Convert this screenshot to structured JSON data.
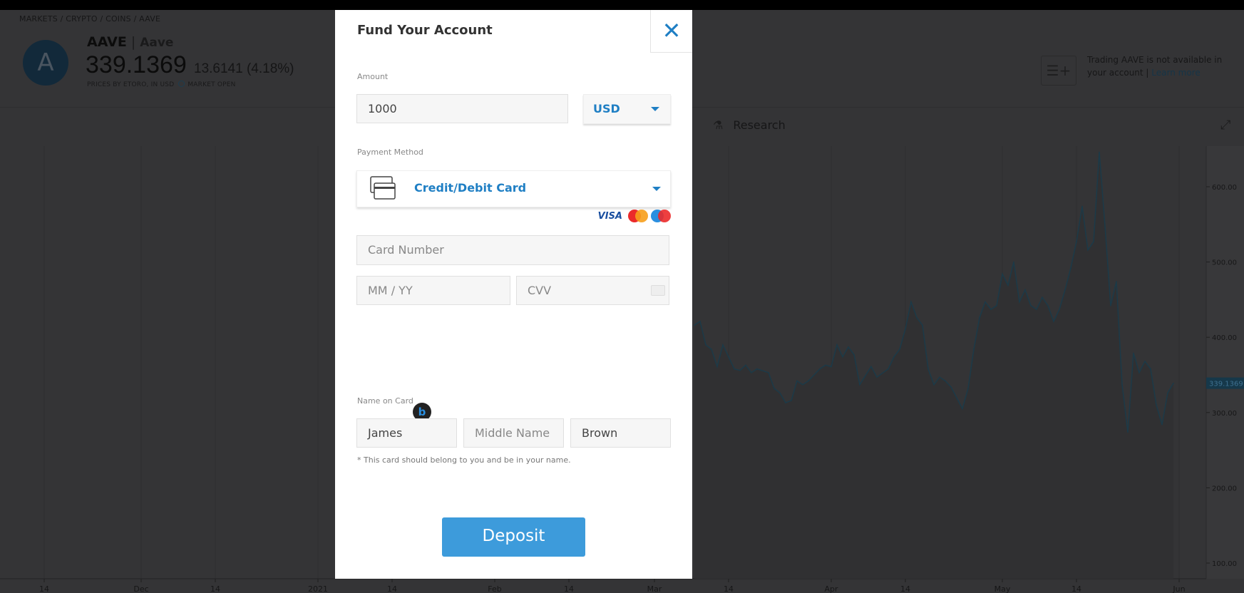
{
  "header": {
    "breadcrumb": "MARKETS / CRYPTO / COINS / AAVE",
    "symbol": "AAVE",
    "separator": "|",
    "name": "Aave",
    "price": "339.1369",
    "change": "13.6141 (4.18%)",
    "source": "PRICES BY ETORO, IN USD",
    "market_status": "MARKET OPEN",
    "logo_letter": "A",
    "unavailable_text": "Trading AAVE is not available in your account |",
    "learn_more": "Learn more",
    "research_tab": "Research"
  },
  "modal": {
    "title": "Fund Your Account",
    "amount_label": "Amount",
    "amount_value": "1000",
    "currency": "USD",
    "payment_label": "Payment Method",
    "payment_method": "Credit/Debit Card",
    "card_logos": [
      "VISA",
      "mastercard",
      "maestro"
    ],
    "card_number_placeholder": "Card Number",
    "expiry_placeholder": "MM / YY",
    "cvv_placeholder": "CVV",
    "name_label": "Name on Card",
    "first_name": "James",
    "middle_placeholder": "Middle Name",
    "last_name": "Brown",
    "note": "* This card should belong to you and be in your name.",
    "deposit_label": "Deposit",
    "pin_letter": "b"
  },
  "colors": {
    "accent": "#1f7fc4",
    "deposit_button": "#3d9bdb",
    "chart_line": "#1a8fc0",
    "overlay": "rgba(15,15,17,0.85)"
  },
  "chart_data": {
    "type": "area",
    "current_price_label": "339.1369",
    "y_ticks": [
      "100.00",
      "200.00",
      "300.00",
      "400.00",
      "500.00",
      "600.00"
    ],
    "ylim": [
      60,
      700
    ],
    "x_ticks": [
      {
        "date": "2020-11-14",
        "label": "14"
      },
      {
        "date": "2020-12-01",
        "label": "Dec"
      },
      {
        "date": "2020-12-14",
        "label": "14"
      },
      {
        "date": "2021-01-01",
        "label": "2021"
      },
      {
        "date": "2021-01-14",
        "label": "14"
      },
      {
        "date": "2021-02-01",
        "label": "Feb"
      },
      {
        "date": "2021-02-14",
        "label": "14"
      },
      {
        "date": "2021-03-01",
        "label": "Mar"
      },
      {
        "date": "2021-03-14",
        "label": "14"
      },
      {
        "date": "2021-04-01",
        "label": "Apr"
      },
      {
        "date": "2021-04-14",
        "label": "14"
      },
      {
        "date": "2021-05-01",
        "label": "May"
      },
      {
        "date": "2021-05-14",
        "label": "14"
      },
      {
        "date": "2021-06-01",
        "label": "Jun"
      }
    ],
    "grid": true,
    "points": [
      [
        "2021-03-08",
        416
      ],
      [
        "2021-03-09",
        421
      ],
      [
        "2021-03-10",
        390
      ],
      [
        "2021-03-11",
        384
      ],
      [
        "2021-03-12",
        361
      ],
      [
        "2021-03-13",
        390
      ],
      [
        "2021-03-14",
        374
      ],
      [
        "2021-03-15",
        358
      ],
      [
        "2021-03-16",
        356
      ],
      [
        "2021-03-17",
        363
      ],
      [
        "2021-03-18",
        353
      ],
      [
        "2021-03-19",
        358
      ],
      [
        "2021-03-21",
        353
      ],
      [
        "2021-03-22",
        332
      ],
      [
        "2021-03-23",
        326
      ],
      [
        "2021-03-24",
        313
      ],
      [
        "2021-03-25",
        316
      ],
      [
        "2021-03-26",
        342
      ],
      [
        "2021-03-27",
        337
      ],
      [
        "2021-03-28",
        342
      ],
      [
        "2021-03-30",
        358
      ],
      [
        "2021-03-31",
        363
      ],
      [
        "2021-04-01",
        361
      ],
      [
        "2021-04-02",
        390
      ],
      [
        "2021-04-03",
        374
      ],
      [
        "2021-04-04",
        387
      ],
      [
        "2021-04-05",
        377
      ],
      [
        "2021-04-06",
        337
      ],
      [
        "2021-04-08",
        361
      ],
      [
        "2021-04-09",
        347
      ],
      [
        "2021-04-11",
        358
      ],
      [
        "2021-04-12",
        374
      ],
      [
        "2021-04-13",
        384
      ],
      [
        "2021-04-14",
        411
      ],
      [
        "2021-04-15",
        447
      ],
      [
        "2021-04-16",
        426
      ],
      [
        "2021-04-17",
        416
      ],
      [
        "2021-04-18",
        358
      ],
      [
        "2021-04-19",
        337
      ],
      [
        "2021-04-20",
        347
      ],
      [
        "2021-04-21",
        342
      ],
      [
        "2021-04-22",
        334
      ],
      [
        "2021-04-24",
        305
      ],
      [
        "2021-04-25",
        332
      ],
      [
        "2021-04-26",
        384
      ],
      [
        "2021-04-27",
        426
      ],
      [
        "2021-04-28",
        447
      ],
      [
        "2021-04-29",
        437
      ],
      [
        "2021-04-30",
        442
      ],
      [
        "2021-05-01",
        484
      ],
      [
        "2021-05-02",
        469
      ],
      [
        "2021-05-03",
        500
      ],
      [
        "2021-05-04",
        447
      ],
      [
        "2021-05-05",
        463
      ],
      [
        "2021-05-06",
        442
      ],
      [
        "2021-05-07",
        437
      ],
      [
        "2021-05-08",
        453
      ],
      [
        "2021-05-09",
        442
      ],
      [
        "2021-05-10",
        421
      ],
      [
        "2021-05-11",
        437
      ],
      [
        "2021-05-12",
        463
      ],
      [
        "2021-05-13",
        492
      ],
      [
        "2021-05-14",
        527
      ],
      [
        "2021-05-15",
        574
      ],
      [
        "2021-05-16",
        516
      ],
      [
        "2021-05-17",
        527
      ],
      [
        "2021-05-18",
        646
      ],
      [
        "2021-05-19",
        548
      ],
      [
        "2021-05-20",
        442
      ],
      [
        "2021-05-21",
        474
      ],
      [
        "2021-05-22",
        337
      ],
      [
        "2021-05-23",
        274
      ],
      [
        "2021-05-24",
        379
      ],
      [
        "2021-05-25",
        353
      ],
      [
        "2021-05-26",
        368
      ],
      [
        "2021-05-27",
        358
      ],
      [
        "2021-05-28",
        310
      ],
      [
        "2021-05-29",
        284
      ],
      [
        "2021-05-30",
        326
      ],
      [
        "2021-05-31",
        339
      ]
    ]
  }
}
